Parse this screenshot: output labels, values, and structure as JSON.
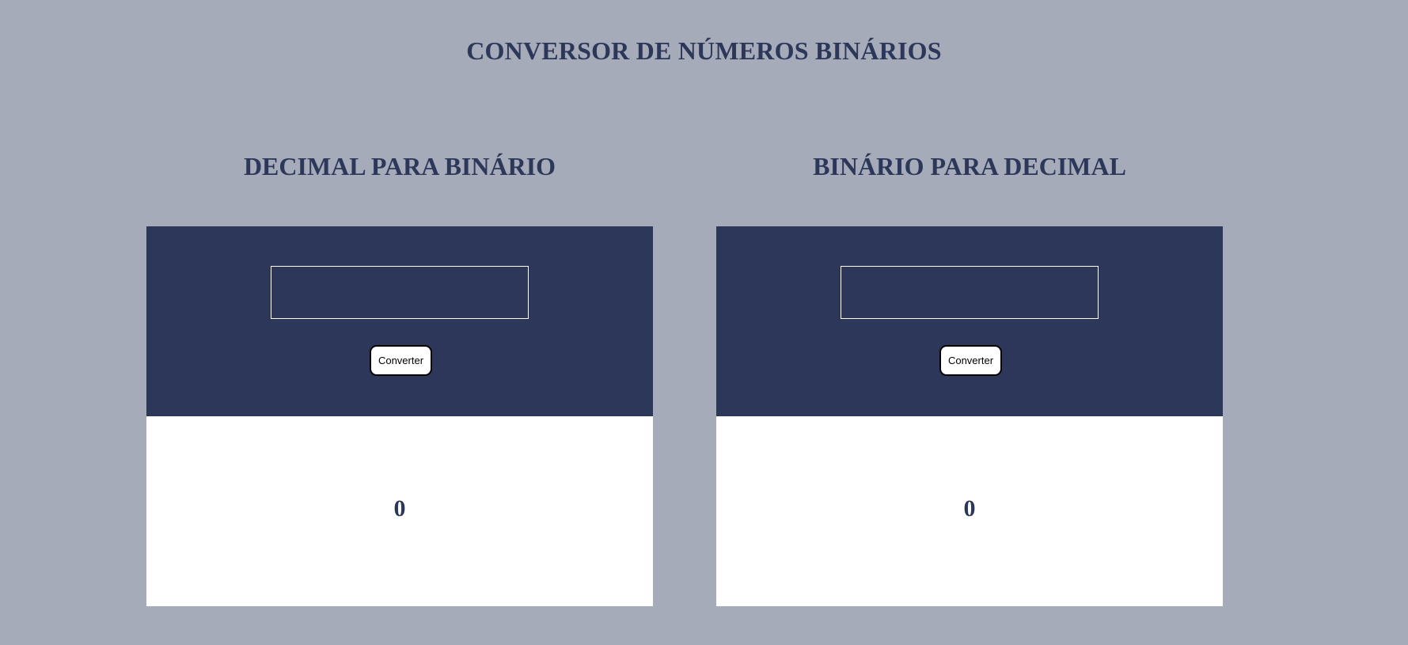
{
  "header": {
    "title": "CONVERSOR DE NÚMEROS BINÁRIOS"
  },
  "decimal_to_binary": {
    "title": "DECIMAL PARA BINÁRIO",
    "input_value": "",
    "button_label": "Converter",
    "result": "0"
  },
  "binary_to_decimal": {
    "title": "BINÁRIO PARA DECIMAL",
    "input_value": "",
    "button_label": "Converter",
    "result": "0"
  },
  "colors": {
    "background": "#a5abb9",
    "accent": "#2d375a",
    "panel_bottom": "#ffffff"
  }
}
